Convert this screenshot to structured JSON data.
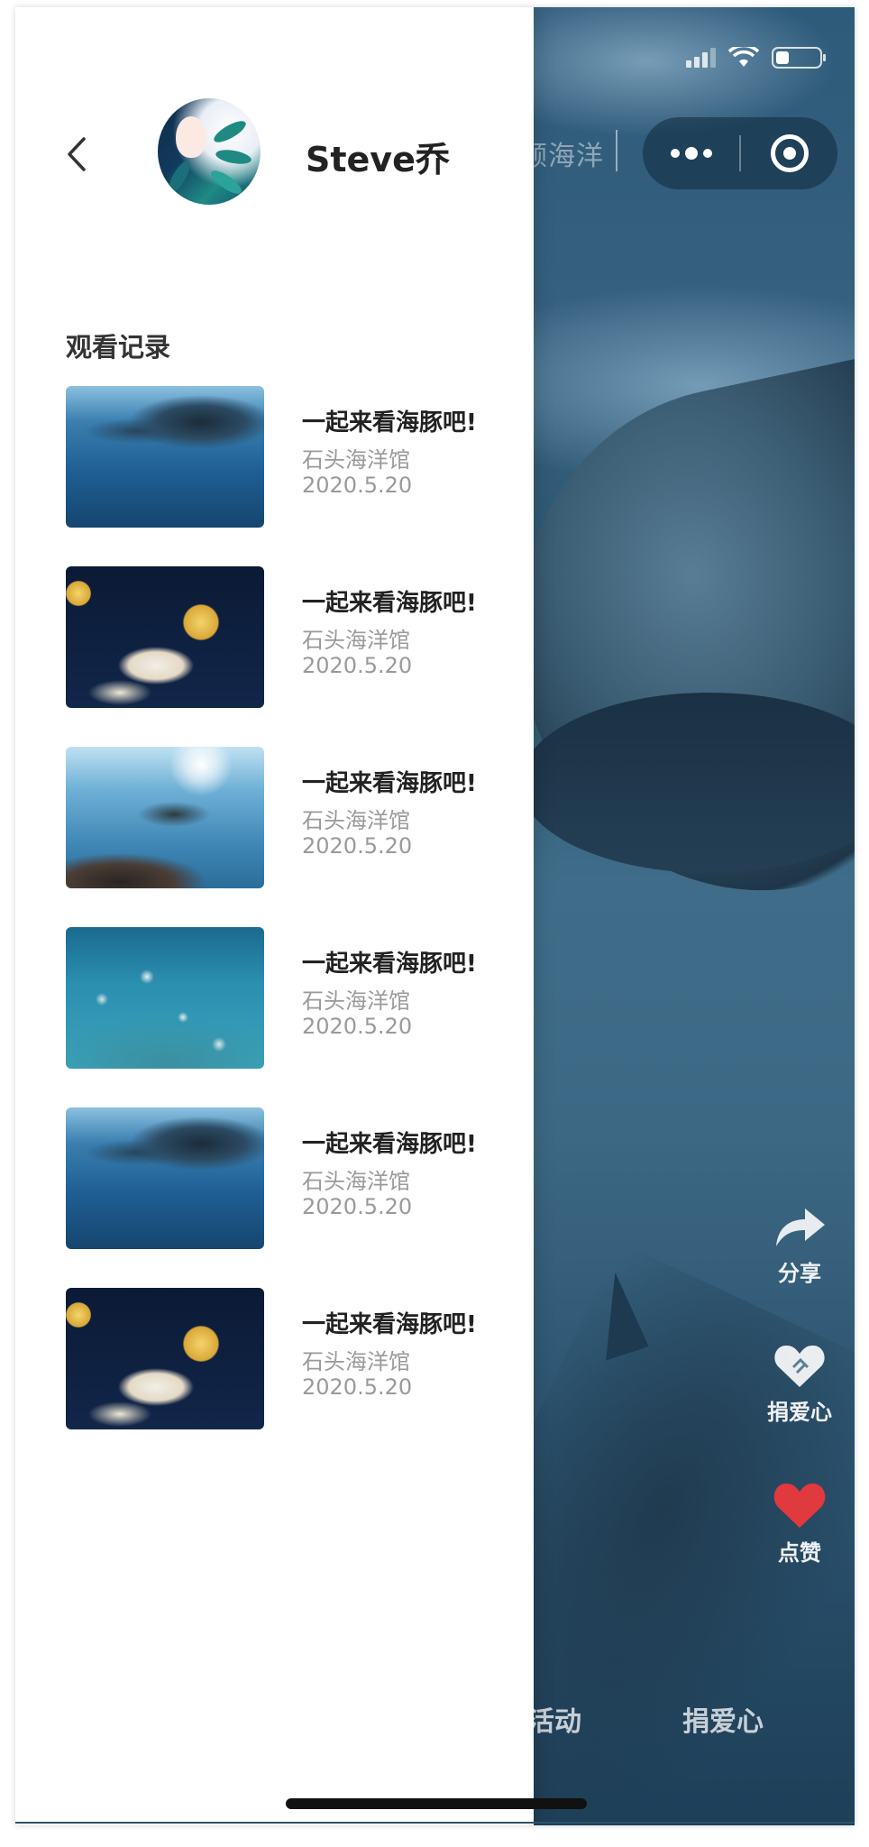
{
  "status_bar": {
    "battery_level": 0.3
  },
  "header": {
    "back_icon": "chevron-left-icon",
    "username": "Steve乔",
    "peek_title": "顾海洋",
    "capsule": {
      "more_icon": "more-dots-icon",
      "target_icon": "target-icon"
    }
  },
  "history": {
    "section_title": "观看记录",
    "items": [
      {
        "title": "一起来看海豚吧!",
        "venue": "石头海洋馆",
        "date": "2020.5.20",
        "thumb": "dolphin"
      },
      {
        "title": "一起来看海豚吧!",
        "venue": "石头海洋馆",
        "date": "2020.5.20",
        "thumb": "jelly"
      },
      {
        "title": "一起来看海豚吧!",
        "venue": "石头海洋馆",
        "date": "2020.5.20",
        "thumb": "turtle"
      },
      {
        "title": "一起来看海豚吧!",
        "venue": "石头海洋馆",
        "date": "2020.5.20",
        "thumb": "fish"
      },
      {
        "title": "一起来看海豚吧!",
        "venue": "石头海洋馆",
        "date": "2020.5.20",
        "thumb": "dolphin"
      },
      {
        "title": "一起来看海豚吧!",
        "venue": "石头海洋馆",
        "date": "2020.5.20",
        "thumb": "jelly"
      }
    ]
  },
  "actions": {
    "share": {
      "label": "分享",
      "icon": "share-arrow-icon"
    },
    "donate": {
      "label": "捐爱心",
      "icon": "heart-hands-icon"
    },
    "like": {
      "label": "点赞",
      "icon": "heart-icon",
      "color": "#e0393e"
    }
  },
  "bottom_tabs": {
    "activity_partial": "活动",
    "donate": "捐爱心"
  }
}
